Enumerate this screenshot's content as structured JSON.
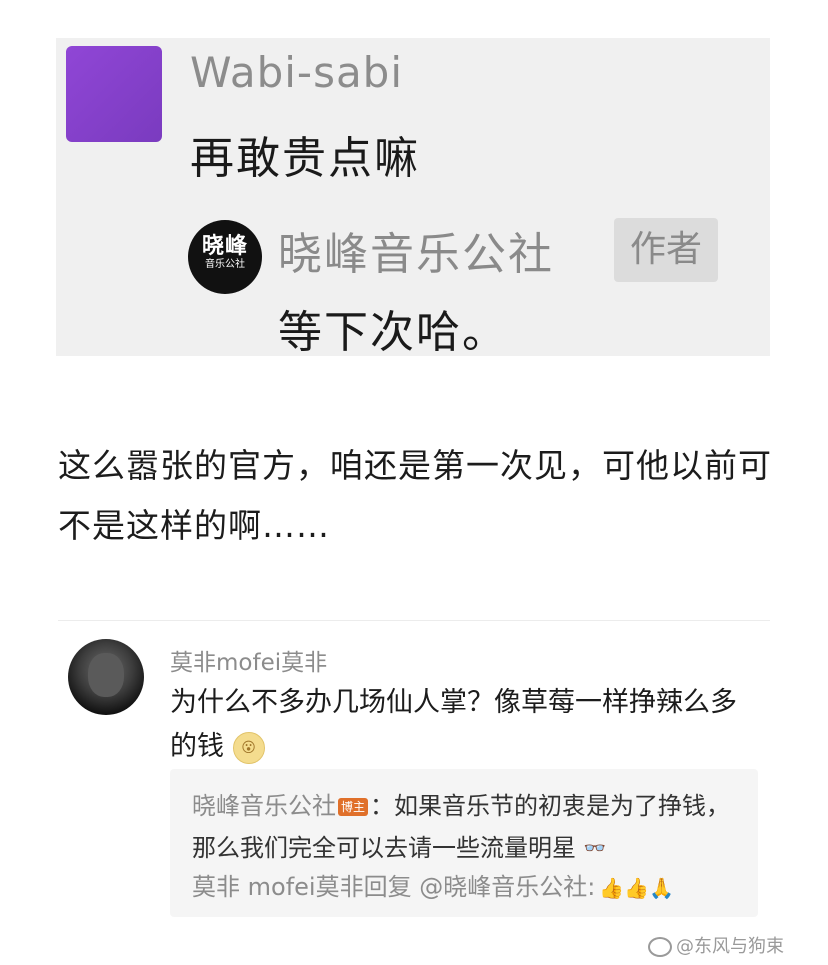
{
  "top_comment": {
    "username": "Wabi-sabi",
    "text": "再敢贵点嘛",
    "reply": {
      "avatar_text_big": "晓峰",
      "avatar_text_small": "音乐公社",
      "username": "晓峰音乐公社",
      "tag": "作者",
      "text": "等下次哈。"
    }
  },
  "article": {
    "paragraph": "这么嚣张的官方，咱还是第一次见，可他以前可不是这样的啊……"
  },
  "bottom_comment": {
    "username": "莫非mofei莫非",
    "text": "为什么不多办几场仙人掌？像草莓一样挣辣么多的钱",
    "emoji_text": "😮",
    "quote": {
      "author": "晓峰音乐公社",
      "badge": "博主",
      "text": "：如果音乐节的初衷是为了挣钱，那么我们完全可以去请一些流量明星",
      "emoji_text": "👓",
      "reply_line": "莫非 mofei莫非回复 @晓峰音乐公社:",
      "thumbs": "👍👍🙏"
    }
  },
  "watermark": {
    "text": "@东风与狗束"
  }
}
